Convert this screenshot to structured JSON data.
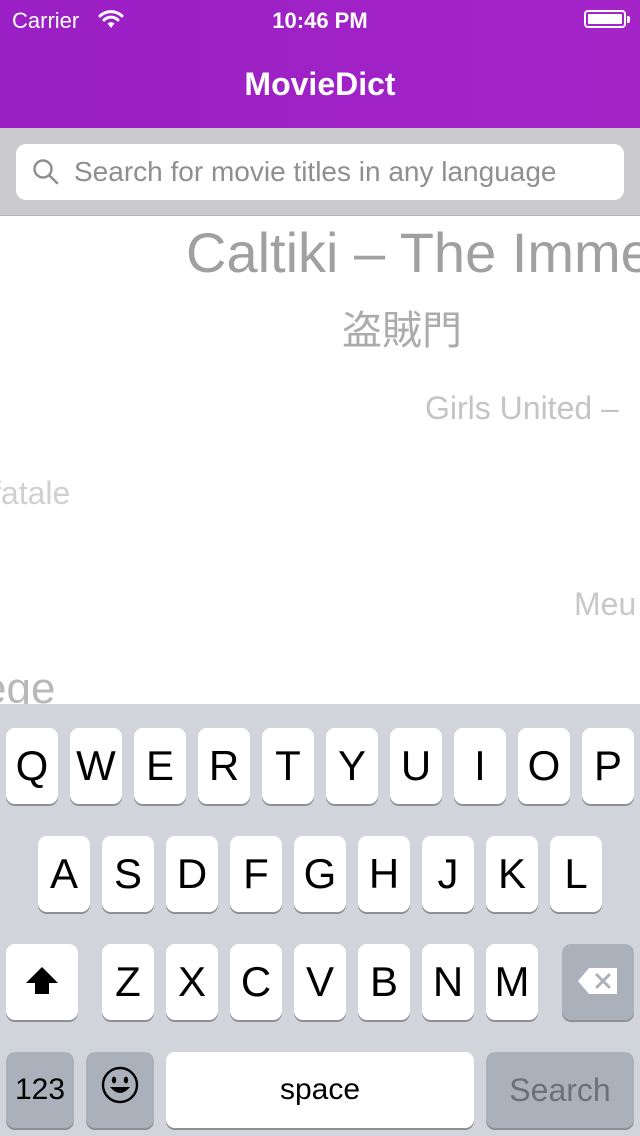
{
  "status_bar": {
    "carrier": "Carrier",
    "time": "10:46 PM",
    "wifi_icon": "wifi-icon",
    "battery_icon": "battery-icon"
  },
  "nav": {
    "title": "MovieDict"
  },
  "search": {
    "placeholder": "Search for movie titles in any language",
    "value": "",
    "icon": "search-icon"
  },
  "movie_titles": [
    "Caltiki – The Imme",
    "盗賊門",
    "Girls United –",
    "fatale",
    "Meu",
    "ege"
  ],
  "keyboard": {
    "row1": [
      "Q",
      "W",
      "E",
      "R",
      "T",
      "Y",
      "U",
      "I",
      "O",
      "P"
    ],
    "row2": [
      "A",
      "S",
      "D",
      "F",
      "G",
      "H",
      "J",
      "K",
      "L"
    ],
    "row3": [
      "Z",
      "X",
      "C",
      "V",
      "B",
      "N",
      "M"
    ],
    "numbers_label": "123",
    "space_label": "space",
    "search_label": "Search",
    "shift_icon": "shift-icon",
    "delete_icon": "delete-icon",
    "emoji_icon": "emoji-icon"
  },
  "colors": {
    "nav_background": "#a022c6",
    "search_area_background": "#c9c9ce",
    "keyboard_background": "#d1d5db"
  }
}
